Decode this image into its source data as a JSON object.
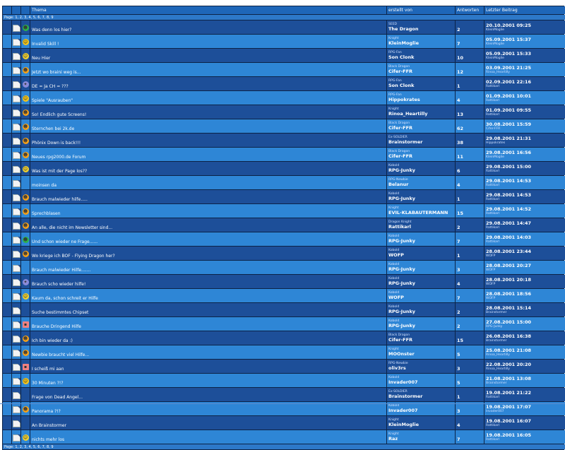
{
  "headers": {
    "col1": "",
    "col2": "",
    "topic": "Thema",
    "author": "erstellt von",
    "answers": "Antworten",
    "last": "Letzter Beitrag"
  },
  "pager": {
    "label": "Page:",
    "pages": [
      "1",
      "2",
      "3",
      "4",
      "5",
      "6",
      "7",
      "8",
      "9"
    ]
  },
  "rows": [
    {
      "mood": "alien",
      "topic": "Was denn los hier?",
      "rank": "SEED",
      "author": "The Dragon",
      "answers": "2",
      "date": "20.10.2001 09:25",
      "lastuser": "KleinMoglie"
    },
    {
      "mood": "smile",
      "topic": "Invalid Skill !",
      "rank": "Knight",
      "author": "KleinMoglie",
      "answers": "7",
      "date": "05.09.2001 15:37",
      "lastuser": "KleinMoglie"
    },
    {
      "mood": "cool",
      "topic": "Neu Hier",
      "rank": "RPG-Fan",
      "author": "Son Clonk",
      "answers": "10",
      "date": "05.09.2001 15:33",
      "lastuser": "KleinMoglie"
    },
    {
      "mood": "grin",
      "topic": "Jetzt wo braini weg is...",
      "rank": "Black Dragon",
      "author": "Cifer-FFR",
      "answers": "12",
      "date": "03.09.2001 21:25",
      "lastuser": "Rinoa_Heartilly"
    },
    {
      "mood": "spin",
      "topic": "DE = Ja CH = ???",
      "rank": "RPG-Fan",
      "author": "Son Clonk",
      "answers": "1",
      "date": "02.09.2001 22:16",
      "lastuser": "Rattikarl"
    },
    {
      "mood": "smile",
      "topic": "Spiele \"Ausrauben\"",
      "rank": "RPG-Fan",
      "author": "Hippokrates",
      "answers": "4",
      "date": "01.09.2001 10:01",
      "lastuser": "Rattikarl"
    },
    {
      "mood": "grin",
      "topic": "So! Endlich gute Screens!",
      "rank": "Knight",
      "author": "Rinoa_Heartilly",
      "answers": "13",
      "date": "01.09.2001 09:55",
      "lastuser": "Rattikarl"
    },
    {
      "mood": "grin",
      "topic": "Sternchen bei 2k.de",
      "rank": "Black Dragon",
      "author": "Cifer-FFR",
      "answers": "62",
      "date": "30.08.2001 15:59",
      "lastuser": "Cifer-FFR"
    },
    {
      "mood": "grin",
      "topic": "Phönix Down is back!!!",
      "rank": "Ex-SOLDIER",
      "author": "Brainstormer",
      "answers": "38",
      "date": "29.08.2001 21:31",
      "lastuser": "Hippokrates"
    },
    {
      "mood": "grin",
      "topic": "Neues rpg2000.de Forum",
      "rank": "Black Dragon",
      "author": "Cifer-FFR",
      "answers": "11",
      "date": "29.08.2001 16:56",
      "lastuser": "KleinMoglie"
    },
    {
      "mood": "cool",
      "topic": "Was ist mit der Page los??",
      "rank": "Kobold",
      "author": "RPG-Junky",
      "answers": "6",
      "date": "29.08.2001 15:00",
      "lastuser": "Rattikarl"
    },
    {
      "mood": "",
      "topic": "moinsen da",
      "rank": "RPG-Newbie",
      "author": "Belanur",
      "answers": "4",
      "date": "29.08.2001 14:53",
      "lastuser": "Rattikarl"
    },
    {
      "mood": "grin",
      "topic": "Brauch malwieder hilfe.....",
      "rank": "Kobold",
      "author": "RPG-Junky",
      "answers": "1",
      "date": "29.08.2001 14:53",
      "lastuser": "Rattikarl"
    },
    {
      "mood": "grin",
      "topic": "Sprechblasen",
      "rank": "Knight",
      "author": "EVIL-KLABAUTERMANN",
      "answers": "15",
      "date": "29.08.2001 14:52",
      "lastuser": "Rattikarl"
    },
    {
      "mood": "grin",
      "topic": "An alle, die nicht im Newsletter sind...",
      "rank": "Dragon Knight",
      "author": "Rattikarl",
      "answers": "2",
      "date": "29.08.2001 14:47",
      "lastuser": "Rattikarl"
    },
    {
      "mood": "alien",
      "topic": "Und schon wieder ne Frage......",
      "rank": "Kobold",
      "author": "RPG-Junky",
      "answers": "7",
      "date": "29.08.2001 14:03",
      "lastuser": "Rattikarl"
    },
    {
      "mood": "grin",
      "topic": "Wo kriege ich BOF - Flying Dragon her?",
      "rank": "Kobold",
      "author": "WOFP",
      "answers": "1",
      "date": "28.08.2001 23:44",
      "lastuser": "WOFP"
    },
    {
      "mood": "",
      "topic": "Brauch malwieder Hilfe.......",
      "rank": "Kobold",
      "author": "RPG-Junky",
      "answers": "3",
      "date": "28.08.2001 20:27",
      "lastuser": "WOFP"
    },
    {
      "mood": "spin",
      "topic": "Brauch scho wieder hilfe!",
      "rank": "Kobold",
      "author": "RPG-Junky",
      "answers": "4",
      "date": "28.08.2001 20:18",
      "lastuser": "WOFP"
    },
    {
      "mood": "cool",
      "topic": "Kaum da, schon schreit er Hilfe",
      "rank": "Kobold",
      "author": "WOFP",
      "answers": "7",
      "date": "28.08.2001 18:56",
      "lastuser": "WOFP"
    },
    {
      "mood": "",
      "topic": "Suche bestimmtes Chipset",
      "rank": "Kobold",
      "author": "RPG-Junky",
      "answers": "2",
      "date": "28.08.2001 15:14",
      "lastuser": "Brainstormer"
    },
    {
      "mood": "box",
      "topic": "Brauche Dringend Hilfe",
      "rank": "Kobold",
      "author": "RPG-Junky",
      "answers": "2",
      "date": "27.08.2001 15:00",
      "lastuser": "RPG-Junky"
    },
    {
      "mood": "grin",
      "topic": "Ich bin wieder da :)",
      "rank": "Black Dragon",
      "author": "Cifer-FFR",
      "answers": "15",
      "date": "26.08.2001 16:38",
      "lastuser": "Brainstormer"
    },
    {
      "mood": "grin",
      "topic": "Newbie braucht viel Hilfe...",
      "rank": "Knight",
      "author": "MOOnster",
      "answers": "5",
      "date": "25.08.2001 21:08",
      "lastuser": "Rinoa_Heartilly"
    },
    {
      "mood": "box",
      "topic": "I scheiß mi aan",
      "rank": "RPG-Newbie",
      "author": "oliv3rs",
      "answers": "3",
      "date": "22.08.2001 20:20",
      "lastuser": "Rinoa_Heartilly"
    },
    {
      "mood": "smile",
      "topic": "30 Minuten ?!?",
      "rank": "Kobold",
      "author": "Invader007",
      "answers": "5",
      "date": "21.08.2001 13:08",
      "lastuser": "Brainstormer"
    },
    {
      "mood": "",
      "topic": "Frage von Dead Angel...",
      "rank": "Ex-SOLDIER",
      "author": "Brainstormer",
      "answers": "1",
      "date": "19.08.2001 21:22",
      "lastuser": "Rattikarl"
    },
    {
      "mood": "grin",
      "topic": "Panorama ?!?",
      "rank": "Kobold",
      "author": "Invader007",
      "answers": "3",
      "date": "19.08.2001 17:07",
      "lastuser": "Invader007"
    },
    {
      "mood": "",
      "topic": "An Brainstormer",
      "rank": "Knight",
      "author": "KleinMoglie",
      "answers": "4",
      "date": "19.08.2001 16:07",
      "lastuser": "Rattikarl"
    },
    {
      "mood": "cool",
      "topic": "nichts mehr los",
      "rank": "Knight",
      "author": "Raz",
      "answers": "7",
      "date": "19.08.2001 16:05",
      "lastuser": "Rattikarl"
    }
  ]
}
